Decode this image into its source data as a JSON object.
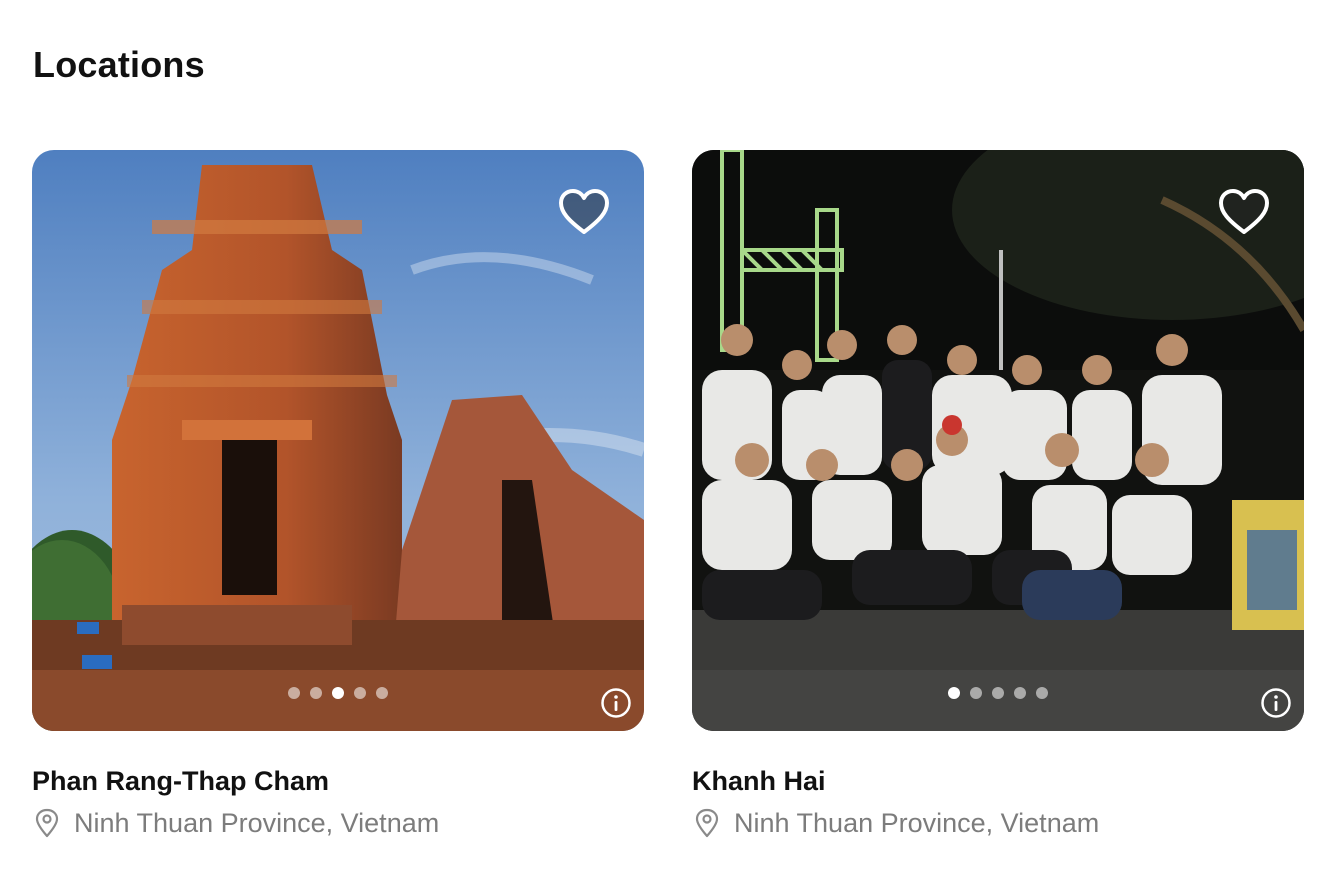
{
  "section": {
    "title": "Locations"
  },
  "cards": [
    {
      "title": "Phan Rang-Thap Cham",
      "location": "Ninh Thuan Province, Vietnam",
      "icons": {
        "favorite": "heart-icon",
        "info": "info-icon",
        "location": "map-pin-icon"
      },
      "slides": {
        "count": 5,
        "active": 3
      },
      "photo": "Brick Cham temple towers under blue sky"
    },
    {
      "title": "Khanh Hai",
      "location": "Ninh Thuan Province, Vietnam",
      "icons": {
        "favorite": "heart-icon",
        "info": "info-icon",
        "location": "map-pin-icon"
      },
      "slides": {
        "count": 5,
        "active": 1
      },
      "photo": "Group of volunteers posing at night"
    }
  ],
  "colors": {
    "title": "#111111",
    "subtext": "#7c7c7c",
    "dot_active": "#ffffff"
  }
}
